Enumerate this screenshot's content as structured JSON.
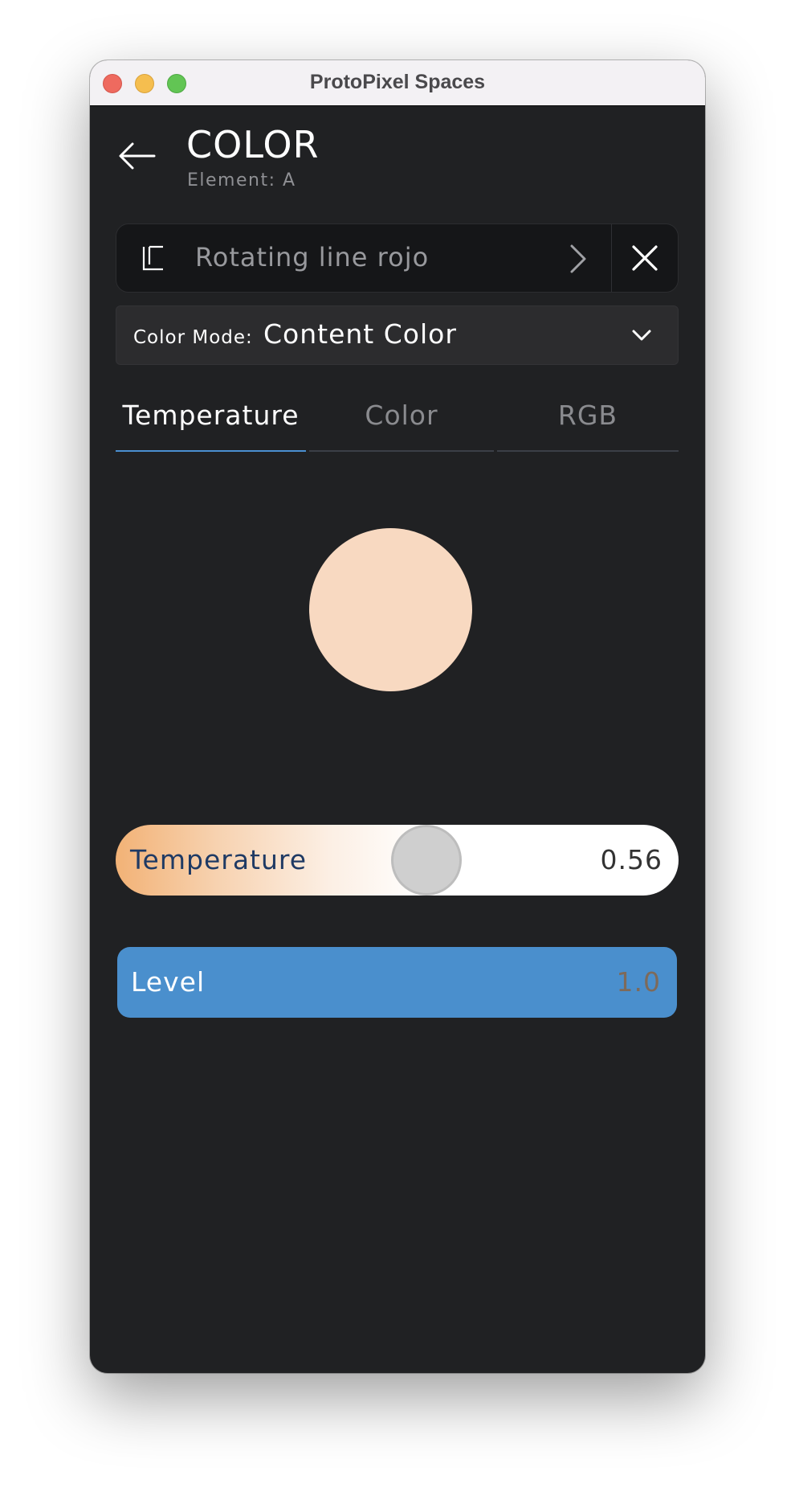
{
  "window": {
    "title": "ProtoPixel Spaces"
  },
  "header": {
    "title": "COLOR",
    "subtitle": "Element: A",
    "back_icon": "arrow-left-icon"
  },
  "content_selector": {
    "icon": "layout-frame-icon",
    "name": "Rotating line rojo",
    "next_icon": "chevron-right-icon",
    "clear_icon": "close-icon"
  },
  "color_mode": {
    "label": "Color Mode:",
    "value": "Content Color",
    "dropdown_icon": "chevron-down-icon"
  },
  "tabs": [
    {
      "label": "Temperature",
      "active": true
    },
    {
      "label": "Color",
      "active": false
    },
    {
      "label": "RGB",
      "active": false
    }
  ],
  "preview": {
    "color": "#f8d9c1"
  },
  "temperature": {
    "label": "Temperature",
    "value_text": "0.56",
    "value": 0.56
  },
  "level": {
    "label": "Level",
    "value_text": "1.0",
    "value": 1.0
  },
  "colors": {
    "background": "#202123",
    "accent": "#4a8fd0",
    "level_fill": "#4a8fcd",
    "warm": "#f2b276"
  }
}
